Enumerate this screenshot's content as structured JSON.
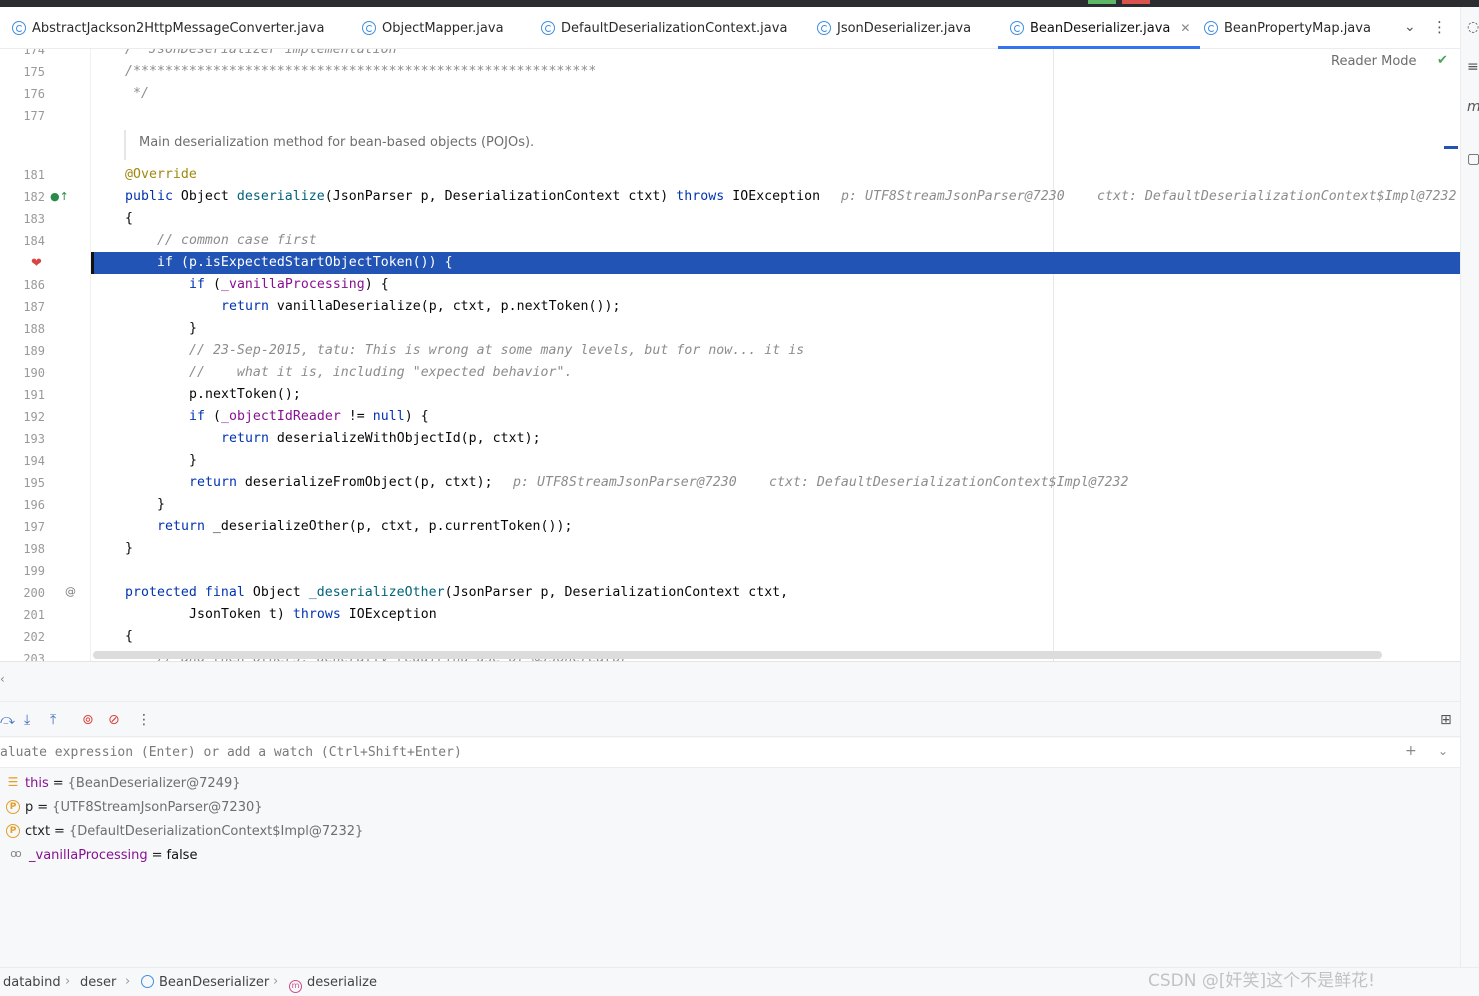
{
  "tabs": [
    {
      "label": "AbstractJackson2HttpMessageConverter.java",
      "active": false
    },
    {
      "label": "ObjectMapper.java",
      "active": false
    },
    {
      "label": "DefaultDeserializationContext.java",
      "active": false
    },
    {
      "label": "JsonDeserializer.java",
      "active": false
    },
    {
      "label": "BeanDeserializer.java",
      "active": true
    },
    {
      "label": "BeanPropertyMap.java",
      "active": false
    }
  ],
  "editor": {
    "reader_mode": "Reader Mode",
    "doc_comment": "Main deserialization method for bean-based objects (POJOs).",
    "line_numbers": [
      "174",
      "175",
      "176",
      "177",
      "181",
      "182",
      "183",
      "184",
      "186",
      "187",
      "188",
      "189",
      "190",
      "191",
      "192",
      "193",
      "194",
      "195",
      "196",
      "197",
      "198",
      "199",
      "200",
      "201",
      "202",
      "203"
    ],
    "lines": {
      "l174": "/* JsonDeserializer implementation",
      "l175": "/**********************************************************",
      "l176": " */",
      "l181": "@Override",
      "l182_kw1": "public",
      "l182_a": " Object ",
      "l182_fn": "deserialize",
      "l182_b": "(JsonParser p, DeserializationContext ctxt) ",
      "l182_kw2": "throws",
      "l182_c": " IOException",
      "l182_hint1": "p: UTF8StreamJsonParser@7230",
      "l182_hint2": "ctxt: DefaultDeserializationContext$Impl@7232",
      "l183": "{",
      "l184": "// common case first",
      "l185": "if (p.isExpectedStartObjectToken()) {",
      "l186_kw": "if",
      "l186_a": " (",
      "l186_fld": "_vanillaProcessing",
      "l186_b": ") {",
      "l187_kw": "return",
      "l187_a": " vanillaDeserialize(p, ctxt, p.nextToken());",
      "l188": "}",
      "l189": "// 23-Sep-2015, tatu: This is wrong at some many levels, but for now... it is",
      "l190": "//    what it is, including \"expected behavior\".",
      "l191": "p.nextToken();",
      "l192_kw": "if",
      "l192_a": " (",
      "l192_fld": "_objectIdReader",
      "l192_b": " != ",
      "l192_kw2": "null",
      "l192_c": ") {",
      "l193_kw": "return",
      "l193_a": " deserializeWithObjectId(p, ctxt);",
      "l194": "}",
      "l195_kw": "return",
      "l195_a": " deserializeFromObject(p, ctxt);",
      "l195_hint1": "p: UTF8StreamJsonParser@7230",
      "l195_hint2": "ctxt: DefaultDeserializationContext$Impl@7232",
      "l196": "}",
      "l197_kw": "return",
      "l197_a": " _deserializeOther(p, ctxt, p.currentToken());",
      "l198": "}",
      "l200_kw1": "protected",
      "l200_kw2": "final",
      "l200_a": " Object ",
      "l200_fn": "_deserializeOther",
      "l200_b": "(JsonParser p, DeserializationContext ctxt,",
      "l201_a": "JsonToken t) ",
      "l201_kw": "throws",
      "l201_b": " IOException",
      "l202": "{",
      "l203": "// and then others, generally requiring use of @JsonCreator"
    }
  },
  "debug": {
    "eval_placeholder": "aluate expression (Enter) or add a watch (Ctrl+Shift+Enter)",
    "variables": [
      {
        "icon": "list-icon",
        "name": "this",
        "value": "{BeanDeserializer@7249}"
      },
      {
        "icon": "param-icon",
        "name": "p",
        "value": "{UTF8StreamJsonParser@7230}"
      },
      {
        "icon": "param-icon",
        "name": "ctxt",
        "value": "{DefaultDeserializationContext$Impl@7232}"
      },
      {
        "icon": "watch-icon",
        "name": "_vanillaProcessing",
        "value": "false"
      }
    ]
  },
  "breadcrumbs": [
    "databind",
    "deser",
    "BeanDeserializer",
    "deserialize"
  ],
  "watermark": "CSDN @[奸笑]这个不是鲜花!"
}
